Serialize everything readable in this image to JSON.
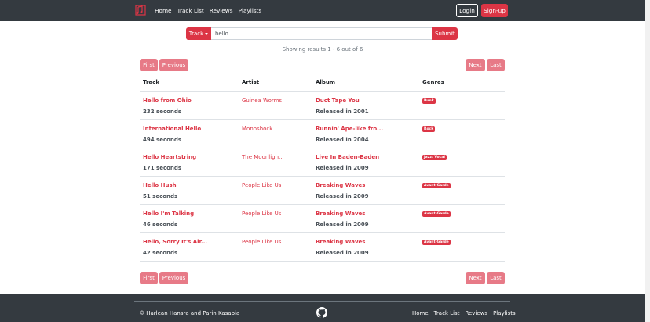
{
  "nav": {
    "links": [
      "Home",
      "Track List",
      "Reviews",
      "Playlists"
    ],
    "login": "Login",
    "signup": "Sign-up"
  },
  "search": {
    "type_label": "Track",
    "query": "hello",
    "submit": "Submit"
  },
  "results_text": "Showing results 1 - 6 out of 6",
  "pagination": {
    "first": "First",
    "previous": "Previous",
    "next": "Next",
    "last": "Last"
  },
  "table": {
    "headers": [
      "Track",
      "Artist",
      "Album",
      "Genres"
    ],
    "rows": [
      {
        "track": "Hello from Ohio",
        "length": "232 seconds",
        "artist": "Guinea Worms",
        "album": "Duct Tape You",
        "released": "Released in 2001",
        "genre": "Punk"
      },
      {
        "track": "International Hello",
        "length": "494 seconds",
        "artist": "Monoshock",
        "album": "Runnin' Ape-like fro...",
        "released": "Released in 2004",
        "genre": "Rock"
      },
      {
        "track": "Hello Heartstring",
        "length": "171 seconds",
        "artist": "The Moonligh...",
        "album": "Live In Baden-Baden",
        "released": "Released in 2009",
        "genre": "Jazz: Vocal"
      },
      {
        "track": "Hello Hush",
        "length": "51 seconds",
        "artist": "People Like Us",
        "album": "Breaking Waves",
        "released": "Released in 2009",
        "genre": "Avant-Garde"
      },
      {
        "track": "Hello I'm Talking",
        "length": "46 seconds",
        "artist": "People Like Us",
        "album": "Breaking Waves",
        "released": "Released in 2009",
        "genre": "Avant-Garde"
      },
      {
        "track": "Hello, Sorry It's Alr...",
        "length": "42 seconds",
        "artist": "People Like Us",
        "album": "Breaking Waves",
        "released": "Released in 2009",
        "genre": "Avant-Garde"
      }
    ]
  },
  "footer": {
    "copyright": "© Harlean Hansra and Parin Kasabia",
    "links": [
      "Home",
      "Track List",
      "Reviews",
      "Playlists"
    ]
  },
  "icons": {
    "brand": "music-logo-icon",
    "footer": "github-icon",
    "dropdown": "caret-down-icon"
  },
  "colors": {
    "accent": "#dc3545",
    "navbar": "#343a40",
    "pager": "#e77a87"
  }
}
